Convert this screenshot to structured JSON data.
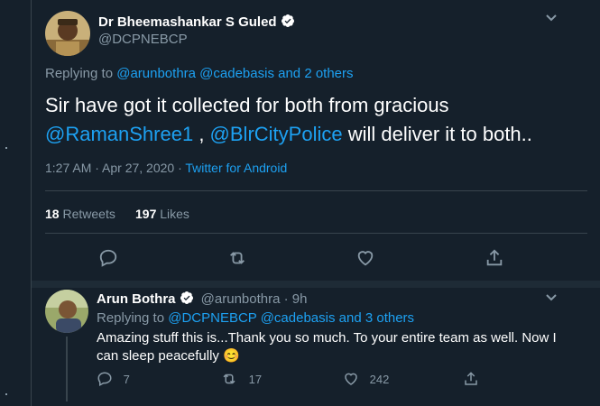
{
  "main_tweet": {
    "author_name": "Dr Bheemashankar S Guled",
    "author_handle": "@DCPNEBCP",
    "replying_prefix": "Replying to",
    "replying_to_1": "@arunbothra",
    "replying_to_2": "@cadebasis",
    "replying_to_more": "and 2 others",
    "text_line1": "Sir have got it collected for both from gracious",
    "mention_1": "@RamanShree1",
    "separator": " , ",
    "mention_2": "@BlrCityPolice",
    "text_tail": " will deliver it to both..",
    "timestamp": "1:27 AM · Apr 27, 2020 · ",
    "source": "Twitter for Android",
    "retweets_count": "18",
    "retweets_label": "Retweets",
    "likes_count": "197",
    "likes_label": "Likes"
  },
  "reply_tweet": {
    "author_name": "Arun Bothra",
    "author_handle": "@arunbothra",
    "time": " · 9h",
    "replying_prefix": "Replying to",
    "replying_to_1": "@DCPNEBCP",
    "replying_to_2": "@cadebasis",
    "replying_to_more": "and 3 others",
    "text_line1": "Amazing stuff this is...Thank you so much. To your entire team as well. Now I",
    "text_line2": "can sleep peacefully",
    "emoji": "😊",
    "reply_count": "7",
    "retweet_count": "17",
    "like_count": "242"
  },
  "icons": [
    "chevron-down-icon",
    "verified-badge-icon",
    "reply-icon",
    "retweet-icon",
    "like-icon",
    "share-icon"
  ],
  "colors": {
    "background": "#15202b",
    "accent": "#1da1f2",
    "muted": "#8899a6",
    "divider": "#38444d"
  }
}
